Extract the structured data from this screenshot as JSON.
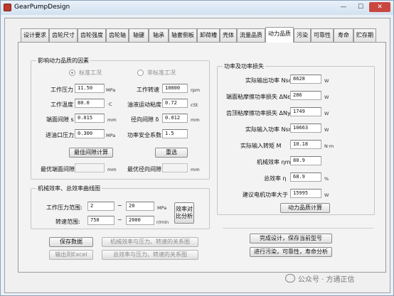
{
  "window": {
    "title": "GearPumpDesign",
    "min_label": "—",
    "max_label": "☐",
    "close_label": "✕"
  },
  "tabs": [
    "设计要求",
    "齿轮尺寸",
    "齿轮强度",
    "齿轮轴",
    "轴键",
    "轴承",
    "轴套侧板",
    "卸荷槽",
    "壳体",
    "流量品质",
    "动力品质",
    "污染",
    "可靠性",
    "寿命",
    "贮存期"
  ],
  "active_tab": "动力品质",
  "influence": {
    "title": "影响动力品质的因素",
    "radio_standard": "标准工况",
    "radio_nonstandard": "非标准工况",
    "rows": [
      {
        "left_label": "工作压力",
        "left_value": "11.50",
        "left_unit": "MPa",
        "right_label": "工作转速",
        "right_value": "10000",
        "right_unit": "rpm"
      },
      {
        "left_label": "工作温度",
        "left_value": "80.0",
        "left_unit": "·C",
        "right_label": "油液运动粘度",
        "right_value": "0.72",
        "right_unit": "cSt"
      },
      {
        "left_label": "端面间隙 s",
        "left_value": "0.015",
        "left_unit": "mm",
        "right_label": "径向间隙 δ",
        "right_value": "0.012",
        "right_unit": "mm"
      },
      {
        "left_label": "进油口压力",
        "left_value": "0.300",
        "left_unit": "MPa",
        "right_label": "功率安全系数",
        "right_value": "1.5",
        "right_unit": ""
      }
    ],
    "btn_best_gap": "最佳间隙计算",
    "btn_reset": "重选",
    "best_end_label": "最优端面间隙",
    "best_end_unit": "mm",
    "best_radial_label": "最优径向间隙",
    "best_radial_unit": "mm"
  },
  "power": {
    "title": "功率及功率损失",
    "rows": [
      {
        "label": "实际输出功率 Nsc",
        "value": "8628",
        "unit": "W"
      },
      {
        "label": "端面粘摩擦功率损失 ΔNε",
        "value": "286",
        "unit": "W"
      },
      {
        "label": "齿顶粘摩擦功率损失 ΔNy",
        "value": "1749",
        "unit": "W"
      },
      {
        "label": "实际输入功率 Nsr",
        "value": "10663",
        "unit": "W"
      },
      {
        "label": "实际输入转矩 M",
        "value": "10.18",
        "unit": "N·m"
      },
      {
        "label": "机械效率 ηm",
        "value": "80.9",
        "unit": ""
      },
      {
        "label": "总效率 η",
        "value": "68.9",
        "unit": "%"
      },
      {
        "label": "建议电机功率大于",
        "value": "15995",
        "unit": "W"
      }
    ],
    "btn_calc": "动力品质计算"
  },
  "curves": {
    "title": "机械效率、总效率曲线图",
    "pressure_label": "工作压力范围:",
    "pressure_from": "2",
    "pressure_to": "20",
    "pressure_unit": "MPa",
    "speed_label": "转速范围:",
    "speed_from": "750",
    "speed_to": "2000",
    "speed_unit": "r/min",
    "tilde": "~",
    "btn_analysis": "效率对比分析"
  },
  "bottom": {
    "btn_save": "保存数据",
    "btn_export": "输出到Excel",
    "btn_mech_curve": "机械效率与压力、转速的关系图",
    "btn_total_curve": "总效率与压力、转速的关系图",
    "btn_finish": "完成设计，保存当前型号",
    "btn_next": "进行污染，可靠性，寿命分析"
  },
  "watermark": "公众号 · 方通正信"
}
